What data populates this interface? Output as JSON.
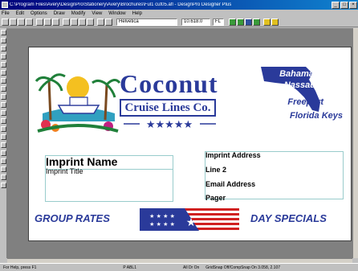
{
  "window": {
    "title": "C:\\Program Files\\Avery\\DesignPro\\Stationery\\Avery\\Brochures\\Ful1 cut05.afl - DesignPro Designer Plus"
  },
  "menu": [
    "File",
    "Edit",
    "Options",
    "Draw",
    "Modify",
    "View",
    "Window",
    "Help"
  ],
  "toolbar": {
    "font_name": "Helvetica",
    "font_size": "10.618.0",
    "style_box": "FL"
  },
  "canvas": {
    "company_line1": "Coconut",
    "company_line2": "Cruise Lines Co.",
    "destinations": [
      "Bahamas",
      "Nassau",
      "Freeport",
      "Florida Keys"
    ],
    "imprint_name": "Imprint Name",
    "imprint_title": "Imprint Title",
    "address_lines": [
      "Imprint Address",
      "Line 2",
      "Email Address",
      "Pager"
    ],
    "group_rates": "GROUP RATES",
    "day_specials": "DAY SPECIALS"
  },
  "status": {
    "help": "For Help, press F1",
    "page": "P ABL1",
    "all_on": "All Dr On",
    "grid": "GridSnap Off/CompSnap On  3.058, 2.107"
  },
  "colors": {
    "brand_blue": "#2a3a9a",
    "flag_red": "#d02020",
    "title_bar": "#00007b"
  }
}
